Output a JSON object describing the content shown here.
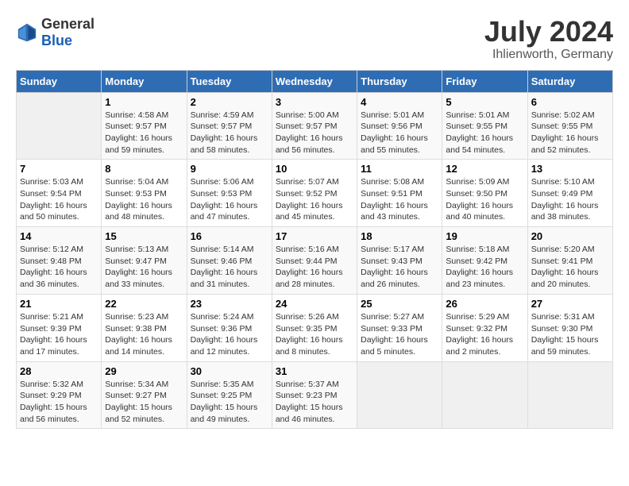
{
  "header": {
    "logo_general": "General",
    "logo_blue": "Blue",
    "title": "July 2024",
    "subtitle": "Ihlienworth, Germany"
  },
  "calendar": {
    "days_of_week": [
      "Sunday",
      "Monday",
      "Tuesday",
      "Wednesday",
      "Thursday",
      "Friday",
      "Saturday"
    ],
    "weeks": [
      [
        {
          "day": "",
          "info": ""
        },
        {
          "day": "1",
          "info": "Sunrise: 4:58 AM\nSunset: 9:57 PM\nDaylight: 16 hours\nand 59 minutes."
        },
        {
          "day": "2",
          "info": "Sunrise: 4:59 AM\nSunset: 9:57 PM\nDaylight: 16 hours\nand 58 minutes."
        },
        {
          "day": "3",
          "info": "Sunrise: 5:00 AM\nSunset: 9:57 PM\nDaylight: 16 hours\nand 56 minutes."
        },
        {
          "day": "4",
          "info": "Sunrise: 5:01 AM\nSunset: 9:56 PM\nDaylight: 16 hours\nand 55 minutes."
        },
        {
          "day": "5",
          "info": "Sunrise: 5:01 AM\nSunset: 9:55 PM\nDaylight: 16 hours\nand 54 minutes."
        },
        {
          "day": "6",
          "info": "Sunrise: 5:02 AM\nSunset: 9:55 PM\nDaylight: 16 hours\nand 52 minutes."
        }
      ],
      [
        {
          "day": "7",
          "info": "Sunrise: 5:03 AM\nSunset: 9:54 PM\nDaylight: 16 hours\nand 50 minutes."
        },
        {
          "day": "8",
          "info": "Sunrise: 5:04 AM\nSunset: 9:53 PM\nDaylight: 16 hours\nand 48 minutes."
        },
        {
          "day": "9",
          "info": "Sunrise: 5:06 AM\nSunset: 9:53 PM\nDaylight: 16 hours\nand 47 minutes."
        },
        {
          "day": "10",
          "info": "Sunrise: 5:07 AM\nSunset: 9:52 PM\nDaylight: 16 hours\nand 45 minutes."
        },
        {
          "day": "11",
          "info": "Sunrise: 5:08 AM\nSunset: 9:51 PM\nDaylight: 16 hours\nand 43 minutes."
        },
        {
          "day": "12",
          "info": "Sunrise: 5:09 AM\nSunset: 9:50 PM\nDaylight: 16 hours\nand 40 minutes."
        },
        {
          "day": "13",
          "info": "Sunrise: 5:10 AM\nSunset: 9:49 PM\nDaylight: 16 hours\nand 38 minutes."
        }
      ],
      [
        {
          "day": "14",
          "info": "Sunrise: 5:12 AM\nSunset: 9:48 PM\nDaylight: 16 hours\nand 36 minutes."
        },
        {
          "day": "15",
          "info": "Sunrise: 5:13 AM\nSunset: 9:47 PM\nDaylight: 16 hours\nand 33 minutes."
        },
        {
          "day": "16",
          "info": "Sunrise: 5:14 AM\nSunset: 9:46 PM\nDaylight: 16 hours\nand 31 minutes."
        },
        {
          "day": "17",
          "info": "Sunrise: 5:16 AM\nSunset: 9:44 PM\nDaylight: 16 hours\nand 28 minutes."
        },
        {
          "day": "18",
          "info": "Sunrise: 5:17 AM\nSunset: 9:43 PM\nDaylight: 16 hours\nand 26 minutes."
        },
        {
          "day": "19",
          "info": "Sunrise: 5:18 AM\nSunset: 9:42 PM\nDaylight: 16 hours\nand 23 minutes."
        },
        {
          "day": "20",
          "info": "Sunrise: 5:20 AM\nSunset: 9:41 PM\nDaylight: 16 hours\nand 20 minutes."
        }
      ],
      [
        {
          "day": "21",
          "info": "Sunrise: 5:21 AM\nSunset: 9:39 PM\nDaylight: 16 hours\nand 17 minutes."
        },
        {
          "day": "22",
          "info": "Sunrise: 5:23 AM\nSunset: 9:38 PM\nDaylight: 16 hours\nand 14 minutes."
        },
        {
          "day": "23",
          "info": "Sunrise: 5:24 AM\nSunset: 9:36 PM\nDaylight: 16 hours\nand 12 minutes."
        },
        {
          "day": "24",
          "info": "Sunrise: 5:26 AM\nSunset: 9:35 PM\nDaylight: 16 hours\nand 8 minutes."
        },
        {
          "day": "25",
          "info": "Sunrise: 5:27 AM\nSunset: 9:33 PM\nDaylight: 16 hours\nand 5 minutes."
        },
        {
          "day": "26",
          "info": "Sunrise: 5:29 AM\nSunset: 9:32 PM\nDaylight: 16 hours\nand 2 minutes."
        },
        {
          "day": "27",
          "info": "Sunrise: 5:31 AM\nSunset: 9:30 PM\nDaylight: 15 hours\nand 59 minutes."
        }
      ],
      [
        {
          "day": "28",
          "info": "Sunrise: 5:32 AM\nSunset: 9:29 PM\nDaylight: 15 hours\nand 56 minutes."
        },
        {
          "day": "29",
          "info": "Sunrise: 5:34 AM\nSunset: 9:27 PM\nDaylight: 15 hours\nand 52 minutes."
        },
        {
          "day": "30",
          "info": "Sunrise: 5:35 AM\nSunset: 9:25 PM\nDaylight: 15 hours\nand 49 minutes."
        },
        {
          "day": "31",
          "info": "Sunrise: 5:37 AM\nSunset: 9:23 PM\nDaylight: 15 hours\nand 46 minutes."
        },
        {
          "day": "",
          "info": ""
        },
        {
          "day": "",
          "info": ""
        },
        {
          "day": "",
          "info": ""
        }
      ]
    ]
  }
}
